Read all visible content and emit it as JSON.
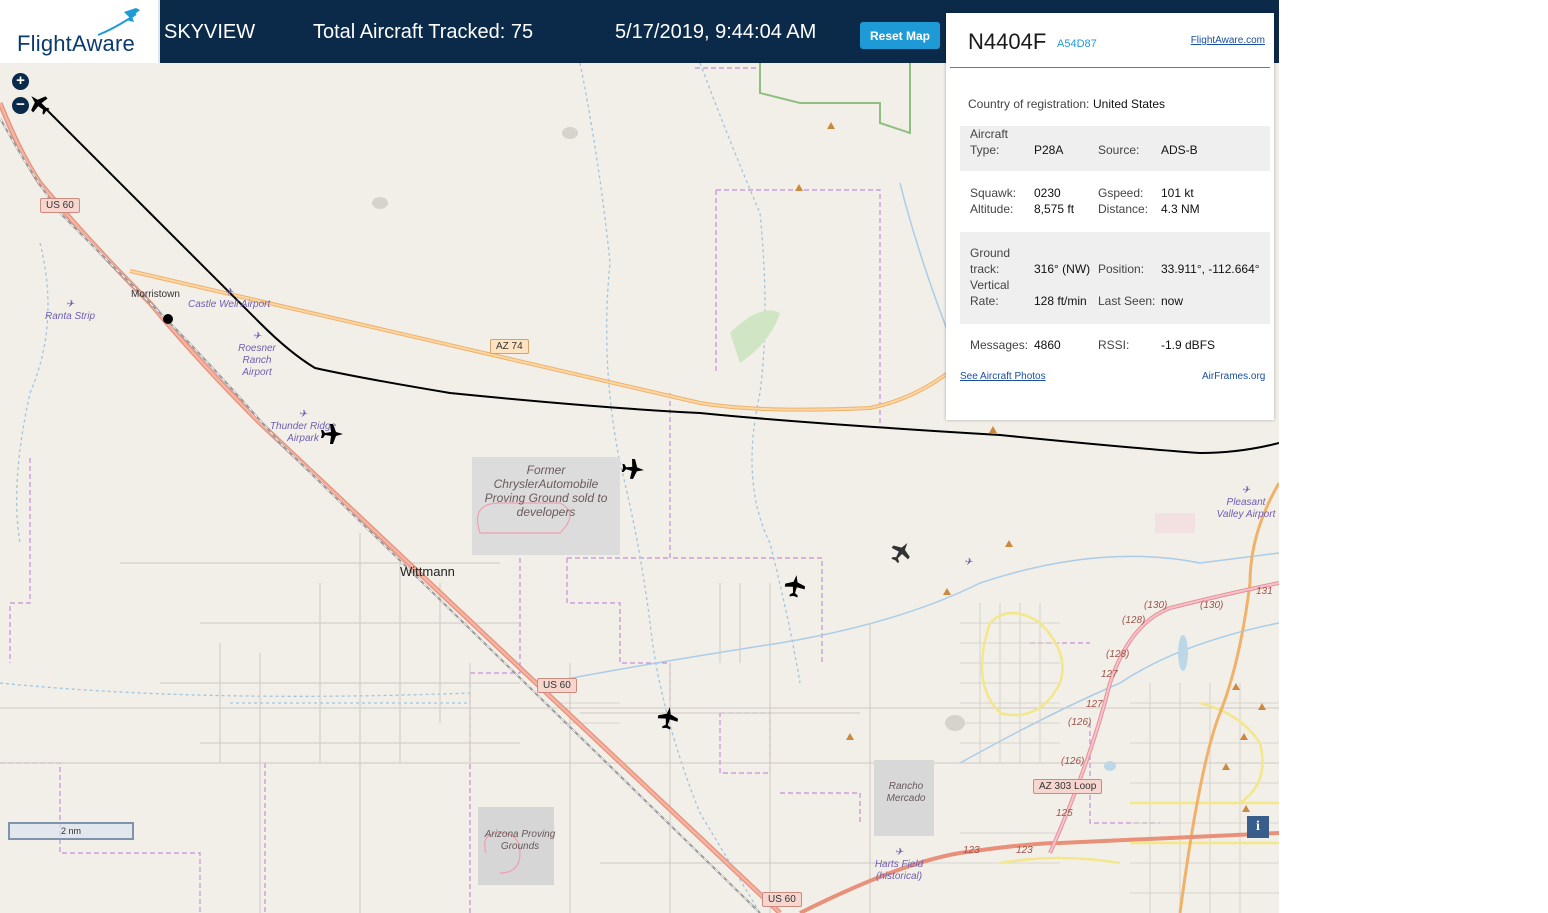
{
  "header": {
    "logo_text": "FlightAware",
    "app_name": "SKYVIEW",
    "total_tracked": "Total Aircraft Tracked: 75",
    "datetime": "5/17/2019, 9:44:04 AM",
    "reset_label": "Reset Map"
  },
  "map": {
    "zoom_in": "+",
    "zoom_out": "−",
    "scale_label": "2 nm",
    "info_label": "i",
    "towns": [
      "Morristown",
      "Wittmann"
    ],
    "airports": [
      "Castle Well Airport",
      "Ranta Strip",
      "Roesner Ranch Airport",
      "Thunder Ridge Airpark",
      "Pleasant Valley Airport",
      "Harts Field (historical)"
    ],
    "areas": [
      "Former ChryslerAutomobile Proving Ground sold to developers",
      "Arizona Proving Grounds",
      "Rancho Mercado"
    ],
    "roads": [
      "US 60",
      "US 60",
      "US 60",
      "AZ 74",
      "AZ 303 Loop"
    ],
    "road_numbers": [
      "(130)",
      "(130)",
      "131",
      "(128)",
      "(128)",
      "127",
      "127",
      "(126)",
      "(126)",
      "125",
      "123",
      "123"
    ]
  },
  "panel": {
    "registration": "N4404F",
    "hex": "A54D87",
    "fa_link": "FlightAware.com",
    "country_label": "Country of registration:",
    "country_value": "United States",
    "aircraft_type_label": "Aircraft Type:",
    "aircraft_type_value": "P28A",
    "source_label": "Source:",
    "source_value": "ADS-B",
    "squawk_label": "Squawk:",
    "squawk_value": "0230",
    "altitude_label": "Altitude:",
    "altitude_value": "8,575 ft",
    "gspeed_label": "Gspeed:",
    "gspeed_value": "101 kt",
    "distance_label": "Distance:",
    "distance_value": "4.3 NM",
    "ground_track_label": "Ground track:",
    "ground_track_value": "316° (NW)",
    "position_label": "Position:",
    "position_value": "33.911°, -112.664°",
    "vertical_rate_label": "Vertical Rate:",
    "vertical_rate_value": "128 ft/min",
    "last_seen_label": "Last Seen:",
    "last_seen_value": "now",
    "messages_label": "Messages:",
    "messages_value": "4860",
    "rssi_label": "RSSI:",
    "rssi_value": "-1.9 dBFS",
    "photos_link": "See Aircraft Photos",
    "airframes_link": "AirFrames.org"
  },
  "colors": {
    "header_bg": "#0b2a4a",
    "accent": "#1e9bd6",
    "map_bg": "#f2efe9",
    "track_line": "#000000"
  }
}
